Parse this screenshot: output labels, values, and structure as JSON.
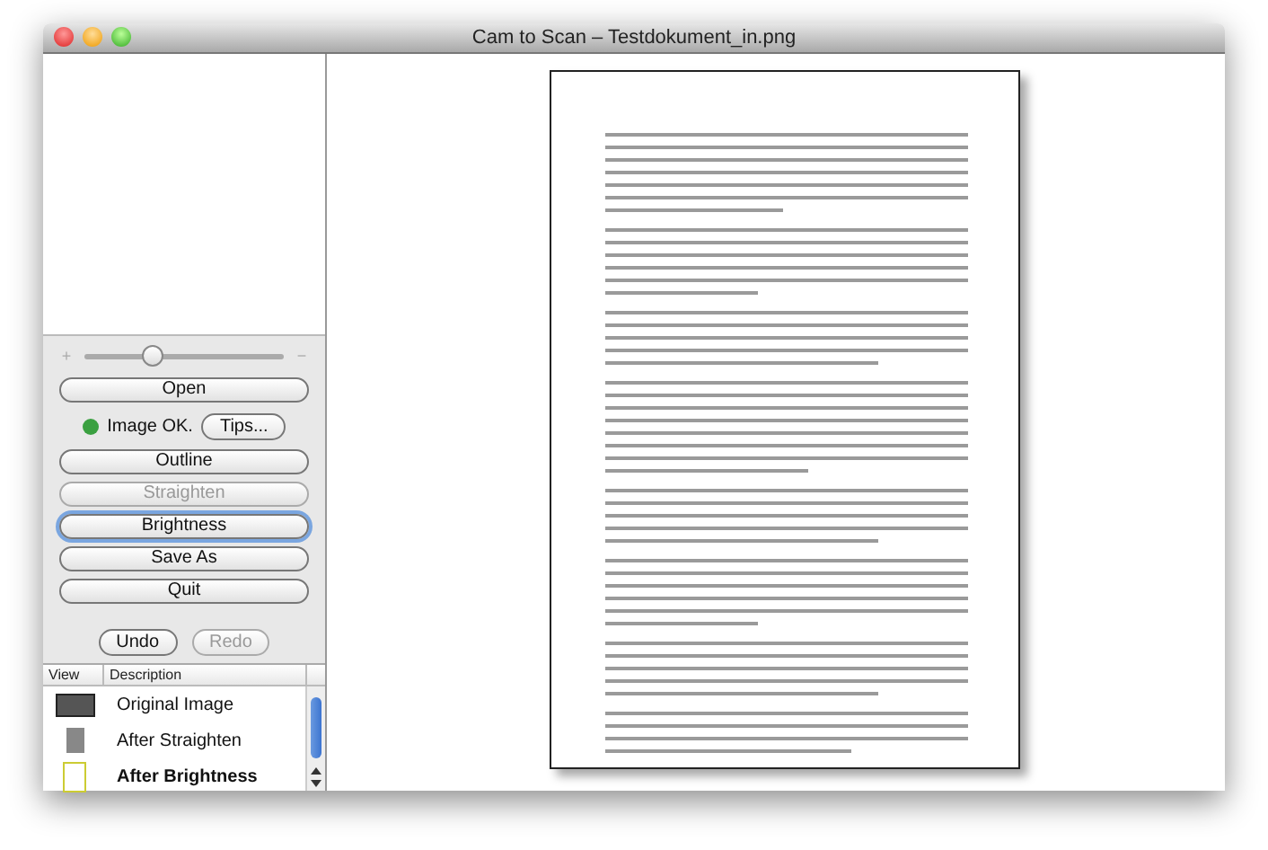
{
  "window": {
    "title": "Cam to Scan – Testdokument_in.png"
  },
  "slider": {
    "min_label": "+",
    "max_label": "−",
    "level": 0.35
  },
  "buttons_top": [
    {
      "label": "Open",
      "disabled": false,
      "focused": false
    }
  ],
  "status": {
    "text": "Image OK.",
    "color": "#3aa040",
    "button": "Tips..."
  },
  "buttons": [
    {
      "label": "Outline",
      "disabled": false,
      "focused": false
    },
    {
      "label": "Straighten",
      "disabled": true,
      "focused": false
    },
    {
      "label": "Brightness",
      "disabled": false,
      "focused": true
    },
    {
      "label": "Save As",
      "disabled": false,
      "focused": false
    },
    {
      "label": "Quit",
      "disabled": false,
      "focused": false
    }
  ],
  "history_buttons": [
    {
      "label": "Undo",
      "disabled": false
    },
    {
      "label": "Redo",
      "disabled": true
    }
  ],
  "table": {
    "columns": [
      "View",
      "Description"
    ],
    "rows": [
      {
        "kind": "dark",
        "description": "Original Image",
        "current": false
      },
      {
        "kind": "grey",
        "description": "After Straighten",
        "current": false
      },
      {
        "kind": "light",
        "description": "After Brightness",
        "current": true
      }
    ]
  }
}
